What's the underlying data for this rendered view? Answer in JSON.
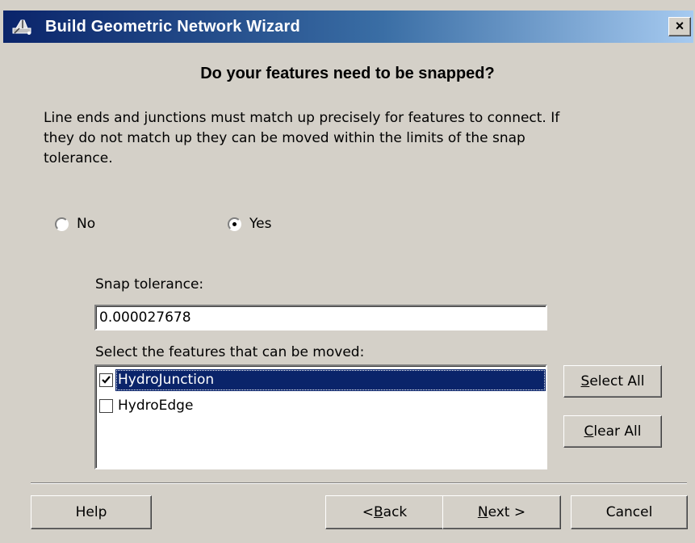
{
  "window": {
    "title": "Build Geometric Network Wizard",
    "close_label": "×",
    "title_icon": "network-wizard-icon"
  },
  "page": {
    "heading": "Do your features need to be snapped?",
    "description": "Line ends and junctions must match up precisely for features to connect.  If they do not match up they can be moved within the limits of the snap tolerance."
  },
  "snap_choice": {
    "options": [
      {
        "label": "No",
        "checked": false
      },
      {
        "label": "Yes",
        "checked": true
      }
    ]
  },
  "snap_tolerance": {
    "label": "Snap tolerance:",
    "value": "0.000027678"
  },
  "features": {
    "label": "Select the features that can be moved:",
    "items": [
      {
        "label": "HydroJunction",
        "checked": true,
        "selected": true
      },
      {
        "label": "HydroEdge",
        "checked": false,
        "selected": false
      }
    ],
    "select_all": {
      "pre": "",
      "mnemonic": "S",
      "post": "elect All"
    },
    "clear_all": {
      "pre": "",
      "mnemonic": "C",
      "post": "lear All"
    }
  },
  "footer": {
    "help": "Help",
    "back": {
      "pre": "< ",
      "mnemonic": "B",
      "post": "ack"
    },
    "next": {
      "pre": "",
      "mnemonic": "N",
      "post": "ext >"
    },
    "cancel": "Cancel"
  }
}
